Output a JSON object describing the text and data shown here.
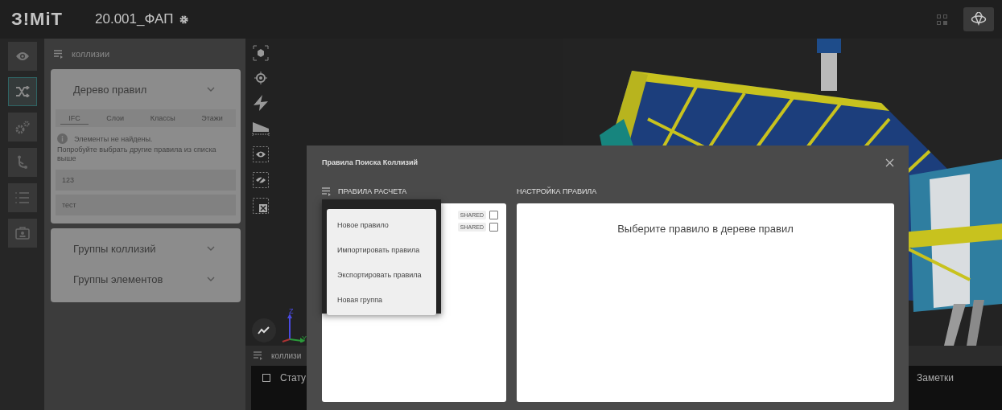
{
  "header": {
    "logo": "З!MiT",
    "project": "20.001_ФАП"
  },
  "rail": [
    {
      "kind": "eye",
      "selected": false
    },
    {
      "kind": "shuffle",
      "selected": true
    },
    {
      "kind": "gears",
      "selected": false
    },
    {
      "kind": "branch",
      "selected": false
    },
    {
      "kind": "list",
      "selected": false
    },
    {
      "kind": "badge",
      "selected": false
    }
  ],
  "panel": {
    "title": "коллизии",
    "sections": [
      {
        "title": "Дерево правил",
        "tabs": [
          {
            "label": "IFC",
            "selected": true
          },
          {
            "label": "Слои",
            "selected": false
          },
          {
            "label": "Классы",
            "selected": false
          },
          {
            "label": "Этажи",
            "selected": false
          }
        ],
        "notice": "Элементы не найдены.",
        "notice_hint": "Попробуйте выбрать другие правила из списка выше",
        "items": [
          "123",
          "тест"
        ]
      },
      {
        "title": "Группы коллизий"
      },
      {
        "title": "Группы элементов"
      }
    ]
  },
  "axes": {
    "z": "Z",
    "y": "Y"
  },
  "bottom_panel": {
    "title": "коллизи",
    "select_all_checked": false,
    "columns": [
      "Стату",
      "Заметки"
    ]
  },
  "dialog": {
    "title": "Правила Поиска Коллизий",
    "rules_header": "ПРАВИЛА РАСЧЕТА",
    "settings_header": "НАСТРОЙКА ПРАВИЛА",
    "rules": [
      {
        "tag": "SHARED",
        "checked": false
      },
      {
        "tag": "SHARED",
        "checked": false
      }
    ],
    "empty_text": "Выберите правило в дереве правил",
    "menu": [
      "Новое правило",
      "Импортировать правила",
      "Экспортировать правила",
      "Новая группа"
    ]
  }
}
